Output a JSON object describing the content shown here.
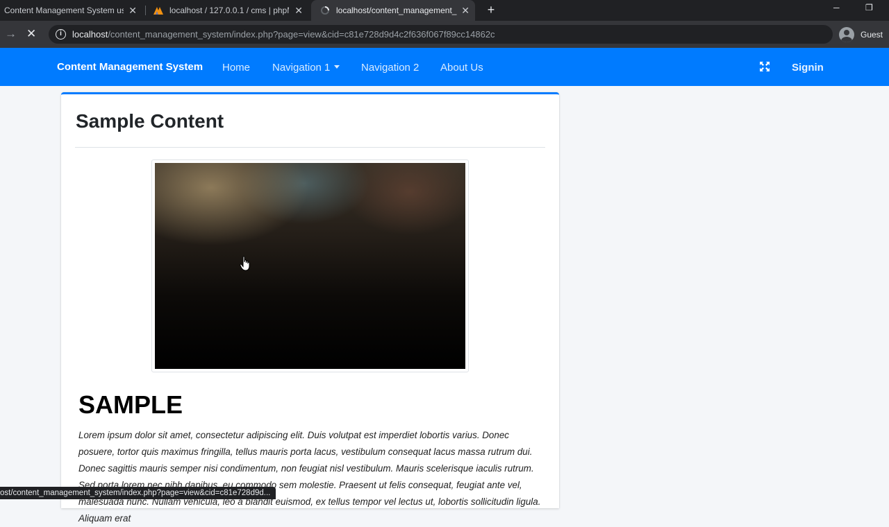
{
  "browser": {
    "tabs": [
      {
        "title": "Content Management System us",
        "active": false,
        "icon": "page-icon"
      },
      {
        "title": "localhost / 127.0.0.1 / cms | phpM",
        "active": false,
        "icon": "phpmyadmin-icon"
      },
      {
        "title": "localhost/content_management_",
        "active": true,
        "icon": "loading-spinner-icon"
      }
    ],
    "url_host": "localhost",
    "url_path": "/content_management_system/index.php?page=view&cid=c81e728d9d4c2f636f067f89cc14862c",
    "profile_label": "Guest",
    "status_url": "ost/content_management_system/index.php?page=view&cid=c81e728d9d..."
  },
  "navbar": {
    "brand": "Content Management System",
    "links": [
      "Home",
      "Navigation 1",
      "Navigation 2",
      "About Us"
    ],
    "signin": "Signin",
    "color": "#007bff"
  },
  "content": {
    "title": "Sample Content",
    "image_alt": "dark blurred photo",
    "heading": "SAMPLE",
    "body": "Lorem ipsum dolor sit amet, consectetur adipiscing elit. Duis volutpat est imperdiet lobortis varius. Donec posuere, tortor quis maximus fringilla, tellus mauris porta lacus, vestibulum consequat lacus massa rutrum dui. Donec sagittis mauris semper nisi condimentum, non feugiat nisl vestibulum. Mauris scelerisque iaculis rutrum. Sed porta lorem nec nibh dapibus, eu commodo sem molestie. Praesent ut felis consequat, feugiat ante vel, malesuada nunc. Nullam vehicula, leo a blandit euismod, ex tellus tempor vel lectus ut, lobortis sollicitudin ligula. Aliquam erat"
  }
}
